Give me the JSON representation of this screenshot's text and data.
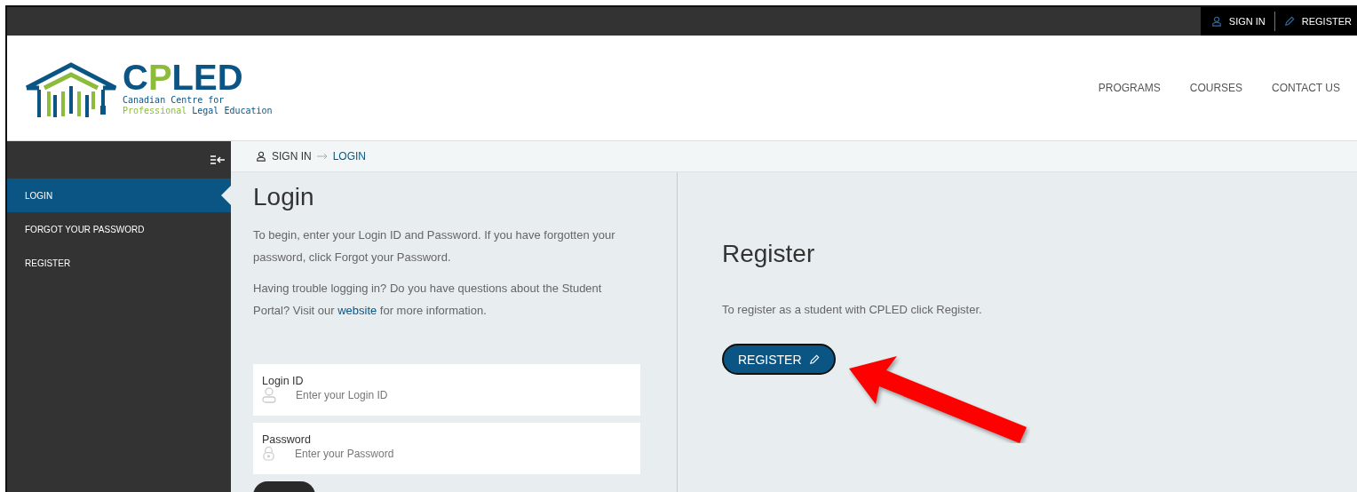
{
  "top_bar": {
    "links": [
      {
        "label": "SIGN IN",
        "kind": "user"
      },
      {
        "label": "REGISTER",
        "kind": "pencil"
      }
    ]
  },
  "logo": {
    "wordmark": "CPLED",
    "tagline": [
      "Canadian Centre for",
      "Professional Legal Education"
    ]
  },
  "nav": [
    "PROGRAMS",
    "COURSES",
    "CONTACT US"
  ],
  "sidebar": {
    "items": [
      {
        "label": "LOGIN",
        "selected": true
      },
      {
        "label": "FORGOT YOUR PASSWORD",
        "selected": false
      },
      {
        "label": "REGISTER",
        "selected": false
      }
    ]
  },
  "breadcrumb": [
    "SIGN IN",
    "LOGIN"
  ],
  "login": {
    "title": "Login",
    "intro": "To begin, enter your Login ID and Password. If you have forgotten your password, click Forgot your Password.",
    "help": {
      "before": "Having trouble logging in? Do you have questions about the Student Portal? Visit our ",
      "link": "website",
      "after": " for more information."
    },
    "fields": [
      {
        "label": "Login ID",
        "placeholder": "Enter your Login ID",
        "kind": "user"
      },
      {
        "label": "Password",
        "placeholder": "Enter your Password",
        "kind": "lock"
      }
    ]
  },
  "register": {
    "title": "Register",
    "text": "To register as a student with CPLED click Register.",
    "button": "REGISTER"
  }
}
